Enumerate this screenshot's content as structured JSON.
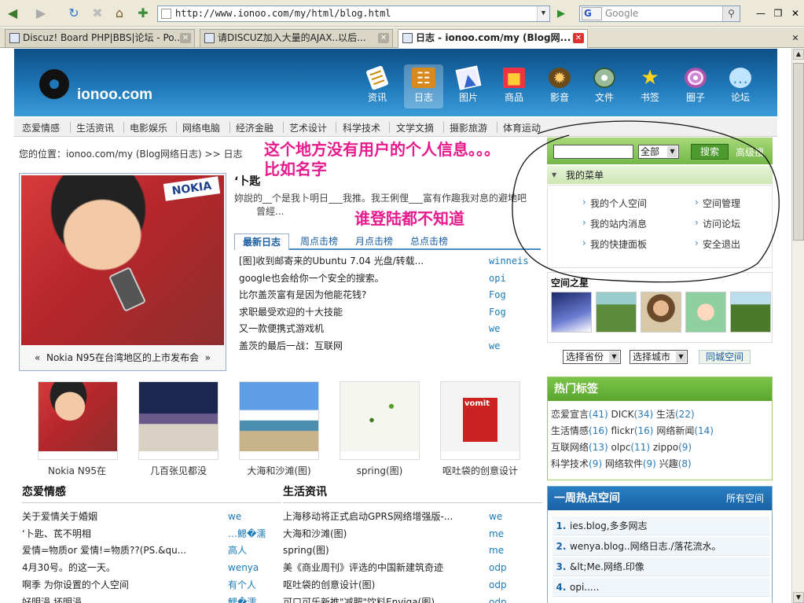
{
  "browser": {
    "url": "http://www.ionoo.com/my/html/blog.html",
    "search_placeholder": "Google",
    "search_engine_label": "G",
    "tabs": [
      {
        "label": "Discuz! Board PHP|BBS|论坛 - Po..."
      },
      {
        "label": "请DISCUZ加入大量的AJAX..以后..."
      },
      {
        "label": "日志 - ionoo.com/my (Blog网..."
      }
    ]
  },
  "site": {
    "logo_text": "ionoo.com",
    "nav": [
      {
        "label": "资讯",
        "icon": "newspaper-icon"
      },
      {
        "label": "日志",
        "icon": "book-icon"
      },
      {
        "label": "图片",
        "icon": "picture-icon"
      },
      {
        "label": "商品",
        "icon": "shopping-bag-icon"
      },
      {
        "label": "影音",
        "icon": "film-reel-icon"
      },
      {
        "label": "文件",
        "icon": "disc-icon"
      },
      {
        "label": "书签",
        "icon": "star-icon"
      },
      {
        "label": "圈子",
        "icon": "swirl-icon"
      },
      {
        "label": "论坛",
        "icon": "chat-bubble-icon"
      }
    ],
    "categories": [
      "恋爱情感",
      "生活资讯",
      "电影娱乐",
      "网络电脑",
      "经济金融",
      "艺术设计",
      "科学技术",
      "文学文摘",
      "摄影旅游",
      "体育运动"
    ]
  },
  "breadcrumb": {
    "text": "您的位置：ionoo.com/my (Blog网络日志) >> 日志"
  },
  "annotations": {
    "note1": "这个地方没有用户的个人信息。。。比如名字",
    "note2": "谁登陆都不知道"
  },
  "feature": {
    "caption": "Nokia N95在台湾地区的上市发布会",
    "prev": "«",
    "next": "»"
  },
  "article": {
    "title": "‘卜匙",
    "summary": "妳說的__个是我卜明日___我推。我王俐俚___富有作趣我对息的避地吧",
    "summary2": "曾經..."
  },
  "list_tabs": [
    "最新日志",
    "周点击榜",
    "月点击榜",
    "总点击榜"
  ],
  "latest": [
    {
      "title": "[图]收到邮寄来的Ubuntu 7.04 光盘/转载...",
      "user": "winneis"
    },
    {
      "title": "google也会给你一个安全的搜索。",
      "user": "opi"
    },
    {
      "title": "比尔盖茨富有是因为他能花钱?",
      "user": "Fog"
    },
    {
      "title": "求职最受欢迎的十大技能",
      "user": "Fog"
    },
    {
      "title": "又一款便携式游戏机",
      "user": "we"
    },
    {
      "title": "盖茨的最后一战：互联网",
      "user": "we"
    }
  ],
  "thumbnails": [
    {
      "caption": "Nokia N95在"
    },
    {
      "caption": "几百张见都没"
    },
    {
      "caption": "大海和沙滩(图)"
    },
    {
      "caption": "spring(图)"
    },
    {
      "caption": "呕吐袋的创意设计"
    }
  ],
  "thumbnail_texts": {
    "vomit": "vomit"
  },
  "love": {
    "title": "恋爱情感",
    "items": [
      {
        "title": "关于爱情关于婚姻",
        "user": "we"
      },
      {
        "title": "‘卜匙、茋不明相",
        "user": "…鰓�濡"
      },
      {
        "title": "爱情=物质or 爱情!=物质??(PS.&qu...",
        "user": "高人"
      },
      {
        "title": "4月30号。的这一天。",
        "user": "wenya"
      },
      {
        "title": "啊季 为你设置的个人空间",
        "user": "有个人"
      },
      {
        "title": "好明涓 坏明涓",
        "user": "鰓�濡"
      }
    ]
  },
  "life": {
    "title": "生活资讯",
    "items": [
      {
        "title": "上海移动将正式启动GPRS网络增强版-...",
        "user": "we"
      },
      {
        "title": "大海和沙滩(图)",
        "user": "me"
      },
      {
        "title": "spring(图)",
        "user": "me"
      },
      {
        "title": "美《商业周刊》评选的中国新建筑奇迹",
        "user": "odp"
      },
      {
        "title": "呕吐袋的创意设计(图)",
        "user": "odp"
      },
      {
        "title": "可口可乐新推\"减肥\"饮料Enviga(图)",
        "user": "odp"
      }
    ]
  },
  "sidebar": {
    "search_button": "搜索",
    "search_scope": "全部",
    "advanced": "高级搜",
    "menu_title": "我的菜单",
    "menu_items": [
      "我的个人空间",
      "空间管理",
      "我的站内消息",
      "访问论坛",
      "我的快捷面板",
      "安全退出"
    ],
    "stars_title": "空间之星",
    "province": "选择省份",
    "city": "选择城市",
    "city_button": "同城空间",
    "tags_title": "热门标签",
    "tags": [
      [
        {
          "name": "恋爱宣言",
          "count": "(41)"
        },
        {
          "name": "DICK",
          "count": "(34)"
        },
        {
          "name": "生活",
          "count": "(22)"
        }
      ],
      [
        {
          "name": "生活情感",
          "count": "(16)"
        },
        {
          "name": "flickr",
          "count": "(16)"
        },
        {
          "name": "网络新闻",
          "count": "(14)"
        }
      ],
      [
        {
          "name": "互联网络",
          "count": "(13)"
        },
        {
          "name": "olpc",
          "count": "(11)"
        },
        {
          "name": "zippo",
          "count": "(9)"
        }
      ],
      [
        {
          "name": "科学技术",
          "count": "(9)"
        },
        {
          "name": "网络软件",
          "count": "(9)"
        },
        {
          "name": "兴趣",
          "count": "(8)"
        }
      ]
    ],
    "week_title": "一周热点空间",
    "week_more": "所有空间",
    "week": [
      {
        "n": "1.",
        "name": "ies.blog,多多网志"
      },
      {
        "n": "2.",
        "name": "wenya.blog..网络日志./落花流水。"
      },
      {
        "n": "3.",
        "name": "&lt;Me.网络.印像"
      },
      {
        "n": "4.",
        "name": "opi....."
      }
    ]
  }
}
